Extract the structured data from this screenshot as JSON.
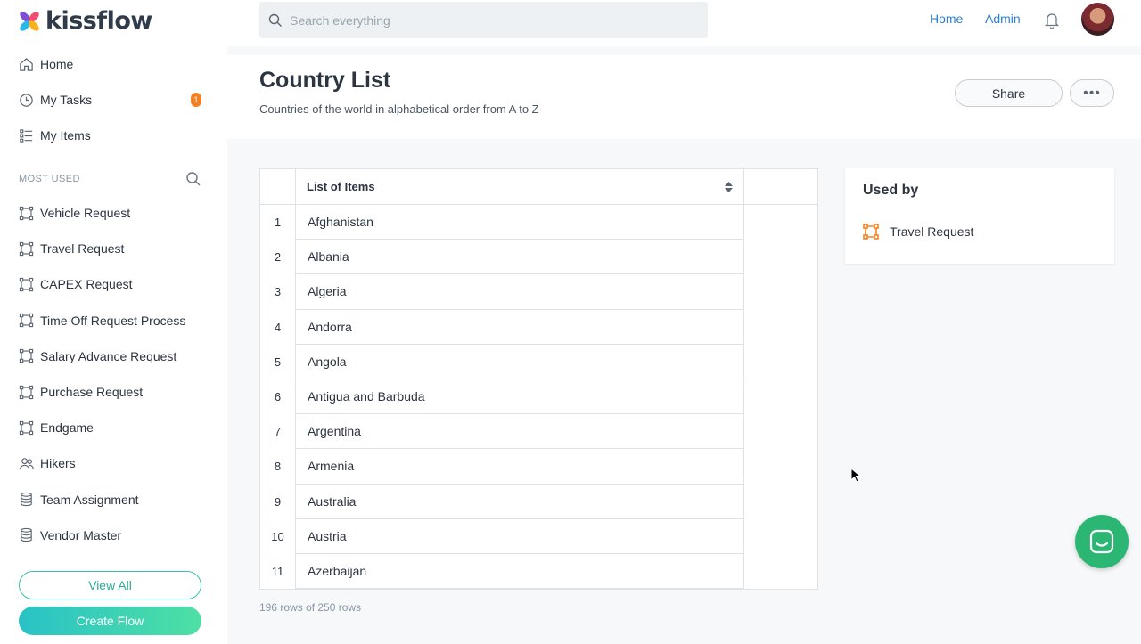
{
  "app": {
    "brand": "kissflow"
  },
  "sidebar": {
    "nav": [
      {
        "label": "Home",
        "icon": "home-icon"
      },
      {
        "label": "My Tasks",
        "icon": "clock-icon",
        "badge": "1"
      },
      {
        "label": "My Items",
        "icon": "list-icon"
      }
    ],
    "section_label": "MOST USED",
    "flows": [
      {
        "label": "Vehicle Request",
        "icon": "flow-icon"
      },
      {
        "label": "Travel Request",
        "icon": "flow-icon"
      },
      {
        "label": "CAPEX Request",
        "icon": "flow-icon"
      },
      {
        "label": "Time Off Request Process",
        "icon": "flow-icon"
      },
      {
        "label": "Salary Advance Request",
        "icon": "flow-icon"
      },
      {
        "label": "Purchase Request",
        "icon": "flow-icon"
      },
      {
        "label": "Endgame",
        "icon": "flow-icon"
      },
      {
        "label": "Hikers",
        "icon": "users-icon"
      },
      {
        "label": "Team Assignment",
        "icon": "database-icon"
      },
      {
        "label": "Vendor Master",
        "icon": "database-icon"
      }
    ],
    "view_all": "View All",
    "create_flow": "Create Flow"
  },
  "topbar": {
    "search_placeholder": "Search everything",
    "home_link": "Home",
    "admin_link": "Admin"
  },
  "header": {
    "title": "Country List",
    "subtitle": "Countries of the world in alphabetical order from A to Z",
    "share": "Share",
    "more": "•••"
  },
  "table": {
    "column_header": "List of Items",
    "rows": [
      {
        "num": "1",
        "item": "Afghanistan"
      },
      {
        "num": "2",
        "item": "Albania"
      },
      {
        "num": "3",
        "item": "Algeria"
      },
      {
        "num": "4",
        "item": "Andorra"
      },
      {
        "num": "5",
        "item": "Angola"
      },
      {
        "num": "6",
        "item": "Antigua and Barbuda"
      },
      {
        "num": "7",
        "item": "Argentina"
      },
      {
        "num": "8",
        "item": "Armenia"
      },
      {
        "num": "9",
        "item": "Australia"
      },
      {
        "num": "10",
        "item": "Austria"
      },
      {
        "num": "11",
        "item": "Azerbaijan"
      }
    ],
    "row_count": "196 rows of 250 rows"
  },
  "used_by": {
    "title": "Used by",
    "items": [
      {
        "label": "Travel Request",
        "icon": "flow-icon",
        "color": "#f58220"
      }
    ]
  },
  "colors": {
    "accent": "#2d7fd3",
    "brand_green": "#3cc3a6",
    "badge": "#f58220",
    "chat": "#2bb673"
  }
}
